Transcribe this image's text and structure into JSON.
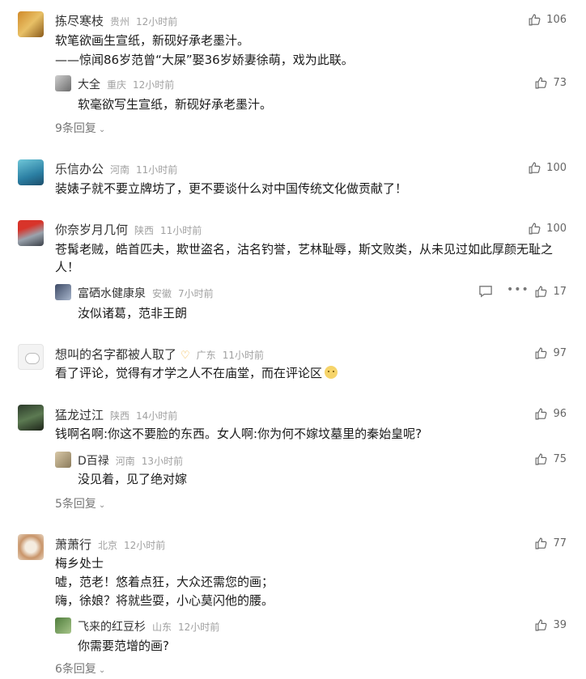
{
  "comments": [
    {
      "name": "拣尽寒枝",
      "loc": "贵州",
      "time": "12小时前",
      "likes": "106",
      "lines": [
        "软笔欲画生宣纸，新砚好承老墨汁。",
        "——惊闻86岁范曾“大屎”娶36岁娇妻徐萌，戏为此联。"
      ],
      "reply": {
        "name": "大全",
        "loc": "重庆",
        "time": "12小时前",
        "likes": "73",
        "text": "软毫欲写生宣纸，新砚好承老墨汁。"
      },
      "more": "9条回复"
    },
    {
      "name": "乐信办公",
      "loc": "河南",
      "time": "11小时前",
      "likes": "100",
      "lines": [
        "装婊子就不要立牌坊了，更不要谈什么对中国传统文化做贡献了！"
      ]
    },
    {
      "name": "你奈岁月几何",
      "loc": "陕西",
      "time": "11小时前",
      "likes": "100",
      "text": "苍髯老贼，皓首匹夫，欺世盗名，沽名钓誉，艺林耻辱，斯文败类，从未见过如此厚颜无耻之人！",
      "reply": {
        "name": "富硒水健康泉",
        "loc": "安徽",
        "time": "7小时前",
        "likes": "17",
        "text": "汝似诸葛，范非王朗"
      }
    },
    {
      "name": "想叫的名字都被人取了",
      "loc": "广东",
      "time": "11小时前",
      "likes": "97",
      "lines": [
        "看了评论，觉得有才学之人不在庙堂，而在评论区"
      ]
    },
    {
      "name": "猛龙过江",
      "loc": "陕西",
      "time": "14小时前",
      "likes": "96",
      "lines": [
        "钱啊名啊:你这不要脸的东西。女人啊:你为何不嫁坟墓里的秦始皇呢?"
      ],
      "reply": {
        "name": "D百禄",
        "loc": "河南",
        "time": "13小时前",
        "likes": "75",
        "text": "没见着，见了绝对嫁"
      },
      "more": "5条回复"
    },
    {
      "name": "萧萧行",
      "loc": "北京",
      "time": "12小时前",
      "likes": "77",
      "lines": [
        "梅乡处士",
        "嘘，范老！悠着点狂，大众还需您的画；",
        "嗨，徐娘？将就些耍，小心莫闪他的腰。"
      ],
      "reply": {
        "name": "飞来的红豆杉",
        "loc": "山东",
        "time": "12小时前",
        "likes": "39",
        "text": "你需要范增的画?"
      },
      "more": "6条回复"
    }
  ],
  "colors": {
    "meta": "#a0a0a0",
    "heart": "#f2b23a"
  },
  "icons": [
    "thumb-up-icon",
    "chevron-down-icon",
    "comment-icon",
    "more-dots-icon",
    "heart-icon"
  ]
}
